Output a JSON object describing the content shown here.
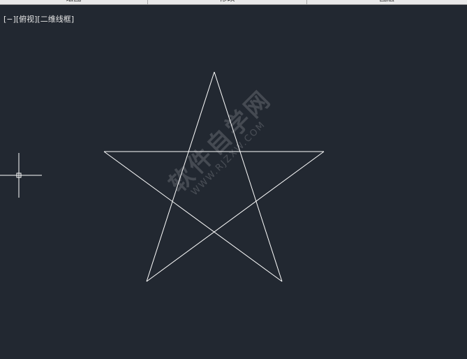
{
  "ribbon": {
    "panels": [
      {
        "label": "绘图"
      },
      {
        "label": "修改"
      },
      {
        "label": "图层"
      }
    ]
  },
  "viewport": {
    "control_minus": "[−]",
    "control_view": "[俯视]",
    "control_style": "[二维线框]"
  },
  "watermark": {
    "main": "软件自学网",
    "sub": "WWW.RJZXW.COM"
  },
  "colors": {
    "background": "#222831",
    "geometry": "#ffffff",
    "ribbon": "#e9e9e9"
  },
  "icons": {
    "cursor": "crosshair-pickbox-icon"
  }
}
